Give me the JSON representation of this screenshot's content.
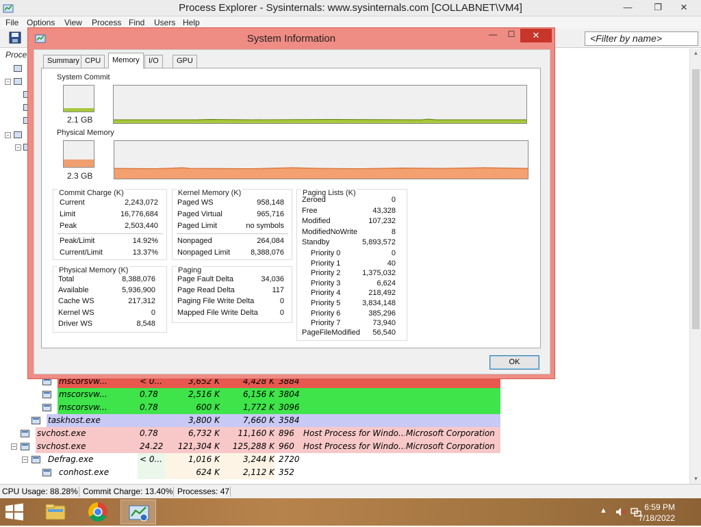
{
  "main_window": {
    "title": "Process Explorer - Sysinternals: www.sysinternals.com [COLLABNET\\VM4]",
    "controls": {
      "minimize": "—",
      "maximize": "❐",
      "close": "✕"
    },
    "menu": [
      "File",
      "Options",
      "View",
      "Process",
      "Find",
      "Users",
      "Help"
    ],
    "filter_placeholder": "<Filter by name>",
    "column_header_partial": "Proce"
  },
  "process_rows": [
    {
      "name": "mscorsvw...",
      "cpu": "< 0...",
      "private": "3,652 K",
      "working": "4,428 K",
      "pid": "3884",
      "desc": "",
      "company": "",
      "name_bg": "#e8584f",
      "rest_bg": "#e8584f",
      "indent": 3
    },
    {
      "name": "mscorsvw...",
      "cpu": "0.78",
      "private": "2,516 K",
      "working": "6,156 K",
      "pid": "3804",
      "desc": "",
      "company": "",
      "name_bg": "#3ee44a",
      "rest_bg": "#3ee44a",
      "indent": 3
    },
    {
      "name": "mscorsvw...",
      "cpu": "0.78",
      "private": "600 K",
      "working": "1,772 K",
      "pid": "3096",
      "desc": "",
      "company": "",
      "name_bg": "#3ee44a",
      "rest_bg": "#3ee44a",
      "indent": 3
    },
    {
      "name": "taskhost.exe",
      "cpu": "",
      "private": "3,800 K",
      "working": "7,660 K",
      "pid": "3584",
      "desc": "",
      "company": "",
      "name_bg": "#c9c9f5",
      "rest_bg": "#c9c9f5",
      "indent": 2
    },
    {
      "name": "svchost.exe",
      "cpu": "0.78",
      "private": "6,732 K",
      "working": "11,160 K",
      "pid": "896",
      "desc": "Host Process for Windo...",
      "company": "Microsoft Corporation",
      "name_bg": "#f8c8c8",
      "rest_bg": "#f8c8c8",
      "indent": 1
    },
    {
      "name": "svchost.exe",
      "cpu": "24.22",
      "private": "121,304 K",
      "working": "125,288 K",
      "pid": "960",
      "desc": "Host Process for Windo...",
      "company": "Microsoft Corporation",
      "name_bg": "#f8c8c8",
      "rest_bg": "#f8c8c8",
      "indent": 1
    },
    {
      "name": "Defrag.exe",
      "cpu": "< 0...",
      "private": "1,016 K",
      "working": "3,244 K",
      "pid": "2720",
      "desc": "",
      "company": "",
      "name_bg": "#ffffff",
      "rest_bg": "#ffffff",
      "indent": 2
    },
    {
      "name": "conhost.exe",
      "cpu": "",
      "private": "624 K",
      "working": "2,112 K",
      "pid": "352",
      "desc": "",
      "company": "",
      "name_bg": "#ffffff",
      "rest_bg": "#ffffff",
      "indent": 3
    }
  ],
  "status_bar": {
    "cpu_usage": "CPU Usage: 88.28%",
    "commit_charge": "Commit Charge: 13.40%",
    "processes": "Processes: 47"
  },
  "taskbar": {
    "time": "6:59 PM",
    "date": "7/18/2022"
  },
  "dialog": {
    "title": "System Information",
    "close_glyph": "✕",
    "min_glyph": "—",
    "max_glyph": "☐",
    "tabs": [
      "Summary",
      "CPU",
      "Memory",
      "I/O",
      "GPU"
    ],
    "active_tab": "Memory",
    "ok_label": "OK",
    "system_commit": {
      "label": "System Commit",
      "value": "2.1 GB",
      "fill_fraction": 0.134,
      "color": "#a8c83c"
    },
    "physical_memory": {
      "label": "Physical Memory",
      "value": "2.3 GB",
      "fill_fraction": 0.29,
      "color": "#f0a070"
    },
    "commit_charge": {
      "title": "Commit Charge (K)",
      "rows": [
        {
          "label": "Current",
          "value": "2,243,072"
        },
        {
          "label": "Limit",
          "value": "16,776,684"
        },
        {
          "label": "Peak",
          "value": "2,503,440"
        }
      ],
      "rows2": [
        {
          "label": "Peak/Limit",
          "value": "14.92%"
        },
        {
          "label": "Current/Limit",
          "value": "13.37%"
        }
      ]
    },
    "kernel_memory": {
      "title": "Kernel Memory (K)",
      "rows": [
        {
          "label": "Paged WS",
          "value": "958,148"
        },
        {
          "label": "Paged Virtual",
          "value": "965,716"
        },
        {
          "label": "Paged Limit",
          "value": "no symbols"
        }
      ],
      "rows2": [
        {
          "label": "Nonpaged",
          "value": "264,084"
        },
        {
          "label": "Nonpaged Limit",
          "value": "8,388,076"
        }
      ]
    },
    "paging_lists": {
      "title": "Paging Lists (K)",
      "rows": [
        {
          "label": "Zeroed",
          "value": "0"
        },
        {
          "label": "Free",
          "value": "43,328"
        },
        {
          "label": "Modified",
          "value": "107,232"
        },
        {
          "label": "ModifiedNoWrite",
          "value": "8"
        },
        {
          "label": "Standby",
          "value": "5,893,572"
        }
      ],
      "priorities": [
        {
          "label": "Priority 0",
          "value": "0"
        },
        {
          "label": "Priority 1",
          "value": "40"
        },
        {
          "label": "Priority 2",
          "value": "1,375,032"
        },
        {
          "label": "Priority 3",
          "value": "6,624"
        },
        {
          "label": "Priority 4",
          "value": "218,492"
        },
        {
          "label": "Priority 5",
          "value": "3,834,148"
        },
        {
          "label": "Priority 6",
          "value": "385,296"
        },
        {
          "label": "Priority 7",
          "value": "73,940"
        }
      ],
      "footer": {
        "label": "PageFileModified",
        "value": "56,540"
      }
    },
    "physical_memory_k": {
      "title": "Physical Memory (K)",
      "rows": [
        {
          "label": "Total",
          "value": "8,388,076"
        },
        {
          "label": "Available",
          "value": "5,936,900"
        },
        {
          "label": "Cache WS",
          "value": "217,312"
        },
        {
          "label": "Kernel WS",
          "value": "0"
        },
        {
          "label": "Driver WS",
          "value": "8,548"
        }
      ]
    },
    "paging": {
      "title": "Paging",
      "rows": [
        {
          "label": "Page Fault Delta",
          "value": "34,036"
        },
        {
          "label": "Page Read Delta",
          "value": "117"
        },
        {
          "label": "Paging File Write Delta",
          "value": "0"
        },
        {
          "label": "Mapped File Write Delta",
          "value": "0"
        }
      ]
    }
  }
}
